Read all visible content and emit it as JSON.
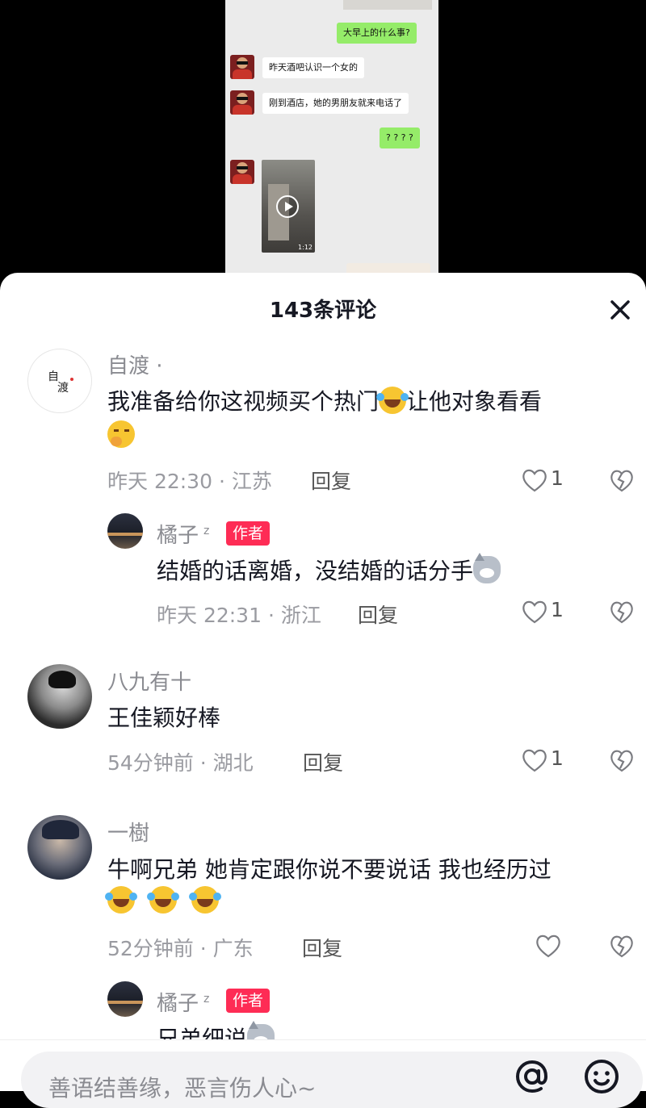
{
  "chat": {
    "messages": [
      {
        "side": "right",
        "text": "大早上的什么事?"
      },
      {
        "side": "left",
        "text": "昨天酒吧认识一个女的"
      },
      {
        "side": "left",
        "text": "刚到酒店，她的男朋友就来电话了"
      },
      {
        "side": "right",
        "text": "? ? ? ?"
      }
    ],
    "video_duration": "1:12"
  },
  "sheet": {
    "title": "143条评论",
    "comments": [
      {
        "user": "自渡 ·",
        "avatar_text": "自\n渡",
        "text": "我准备给你这视频买个热门",
        "text_after_emoji": "让他对象看看",
        "time_loc": "昨天 22:30 · 江苏",
        "reply": "回复",
        "likes": "1"
      },
      {
        "user": "橘子",
        "badge": "作者",
        "text": "结婚的话离婚，没结婚的话分手",
        "time_loc": "昨天 22:31 · 浙江",
        "reply": "回复",
        "likes": "1"
      },
      {
        "user": "八九有十",
        "text": "王佳颖好棒",
        "time_loc": "54分钟前 · 湖北",
        "reply": "回复",
        "likes": "1"
      },
      {
        "user": "一樹",
        "text": "牛啊兄弟 她肯定跟你说不要说话 我也经历过",
        "time_loc": "52分钟前 · 广东",
        "reply": "回复",
        "likes": ""
      },
      {
        "user": "橘子",
        "badge": "作者",
        "text": "兄弟细说"
      }
    ]
  },
  "input": {
    "placeholder": "善语结善缘，恶言伤人心~"
  },
  "colors": {
    "badge": "#fe2c55",
    "bubble_right": "#95ec69",
    "chat_bg": "#ebebeb"
  },
  "icons": [
    "close-icon",
    "heart-icon",
    "broken-heart-icon",
    "at-icon",
    "emoji-icon",
    "play-icon"
  ]
}
